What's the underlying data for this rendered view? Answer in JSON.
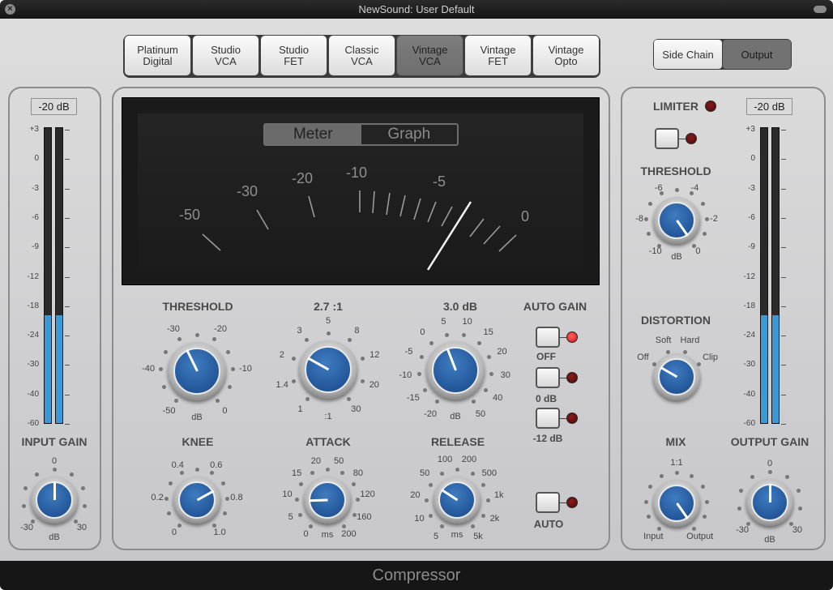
{
  "window": {
    "title": "NewSound: User Default",
    "footer": "Compressor"
  },
  "models": {
    "items": [
      "Platinum\nDigital",
      "Studio\nVCA",
      "Studio\nFET",
      "Classic\nVCA",
      "Vintage\nVCA",
      "Vintage\nFET",
      "Vintage\nOpto"
    ],
    "selected": "Vintage\nVCA"
  },
  "view": {
    "side_chain": "Side Chain",
    "output": "Output",
    "selected": "Output"
  },
  "input": {
    "readout": "-20 dB",
    "scale": [
      "+3",
      "0",
      "-3",
      "-6",
      "-9",
      "-12",
      "-18",
      "-24",
      "-30",
      "-40",
      "-60"
    ],
    "levels_db": [
      -20,
      -20
    ],
    "gain": {
      "title": "INPUT GAIN",
      "labels": [
        "-30",
        "0",
        "30"
      ],
      "unit": "dB",
      "position": 0.5
    }
  },
  "output": {
    "readout": "-20 dB",
    "scale": [
      "+3",
      "0",
      "-3",
      "-6",
      "-9",
      "-12",
      "-18",
      "-24",
      "-30",
      "-40",
      "-60"
    ],
    "levels_db": [
      -20,
      -20
    ],
    "gain": {
      "title": "OUTPUT GAIN",
      "labels": [
        "-30",
        "0",
        "30"
      ],
      "unit": "dB",
      "position": 0.5
    }
  },
  "meter": {
    "tabs": [
      "Meter",
      "Graph"
    ],
    "selected": "Meter",
    "scale": [
      "-50",
      "-30",
      "-20",
      "-10",
      "-5",
      "0"
    ]
  },
  "main": {
    "threshold": {
      "title": "THRESHOLD",
      "labels": [
        "-50",
        "-40",
        "-30",
        "-20",
        "-10",
        "0"
      ],
      "unit": "dB",
      "position": 0.41
    },
    "ratio": {
      "title": "2.7 :1",
      "labels": [
        "1",
        "1.4",
        "2",
        "3",
        "5",
        "8",
        "12",
        "20",
        "30"
      ],
      "unit": ":1",
      "position": 0.29
    },
    "makeup": {
      "title": "3.0 dB",
      "labels": [
        "-20",
        "-15",
        "-10",
        "-5",
        "0",
        "5",
        "10",
        "15",
        "20",
        "30",
        "40",
        "50"
      ],
      "unit": "dB",
      "position": 0.43
    },
    "knee": {
      "title": "KNEE",
      "labels": [
        "0",
        "0.2",
        "0.4",
        "0.6",
        "0.8",
        "1.0"
      ],
      "unit": "",
      "position": 0.71
    },
    "attack": {
      "title": "ATTACK",
      "labels": [
        "0",
        "5",
        "10",
        "15",
        "20",
        "50",
        "80",
        "120",
        "160",
        "200"
      ],
      "unit": "ms",
      "position": 0.19
    },
    "release": {
      "title": "RELEASE",
      "labels": [
        "5",
        "10",
        "20",
        "50",
        "100",
        "200",
        "500",
        "1k",
        "2k",
        "5k"
      ],
      "unit": "ms",
      "position": 0.31
    }
  },
  "auto_gain": {
    "title": "AUTO GAIN",
    "options": [
      {
        "label": "OFF",
        "led_on": true
      },
      {
        "label": "0 dB",
        "led_on": false
      },
      {
        "label": "-12 dB",
        "led_on": false
      }
    ],
    "auto": {
      "label": "AUTO",
      "led_on": false
    }
  },
  "limiter": {
    "title": "LIMITER",
    "led_on": false,
    "threshold": {
      "title": "THRESHOLD",
      "labels": [
        "-10",
        "-8",
        "-6",
        "-4",
        "-2",
        "0"
      ],
      "unit": "dB",
      "position": 1.0
    }
  },
  "distortion": {
    "title": "DISTORTION",
    "labels": [
      "Off",
      "Soft",
      "Hard",
      "Clip"
    ],
    "position": 0.0
  },
  "mix": {
    "title": "MIX",
    "labels": [
      "Input",
      "1:1",
      "Output"
    ],
    "position": 1.0
  },
  "colors": {
    "accent": "#23579a",
    "meter_fill": "#3a9ad6",
    "led_on": "#d31010",
    "led_off": "#5a0c0c"
  }
}
